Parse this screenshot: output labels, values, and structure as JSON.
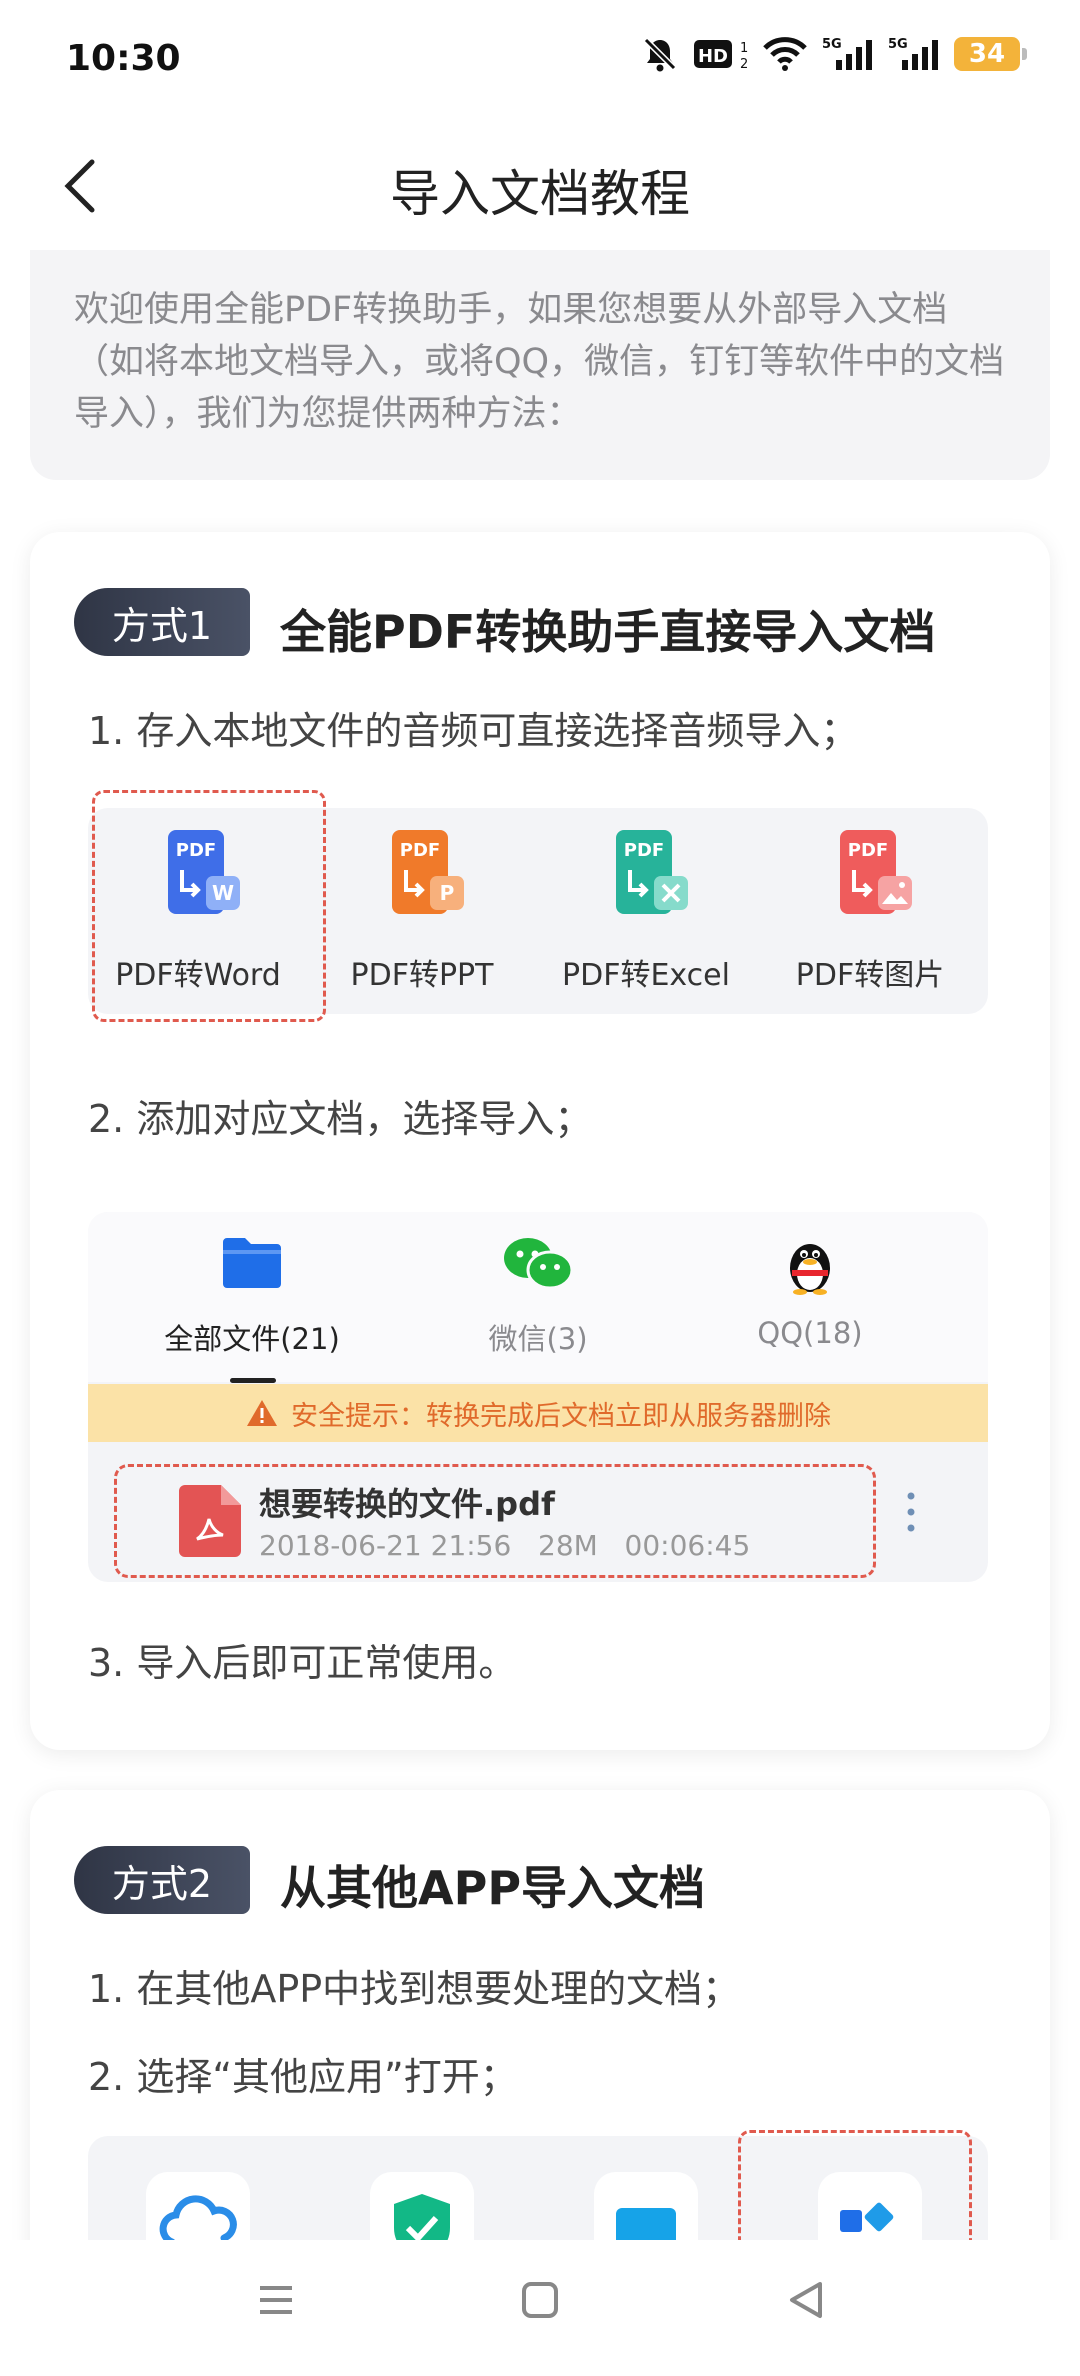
{
  "status_bar": {
    "time": "10:30",
    "battery": "34",
    "icons": [
      "bell-off-icon",
      "hd-icon",
      "wifi-icon",
      "5g-signal-icon",
      "5g-signal-icon",
      "battery-icon"
    ]
  },
  "nav": {
    "title": "导入文档教程",
    "back_icon": "chevron-left-icon"
  },
  "intro": {
    "text": "欢迎使用全能PDF转换助手，如果您想要从外部导入文档（如将本地文档导入，或将QQ，微信，钉钉等软件中的文档导入），我们为您提供两种方法："
  },
  "method1": {
    "badge": "方式1",
    "title": "全能PDF转换助手直接导入文档",
    "step1": "1. 存入本地文件的音频可直接选择音频导入；",
    "tools": [
      {
        "label": "PDF转Word",
        "color": "#3f6ee8",
        "letter": "W"
      },
      {
        "label": "PDF转PPT",
        "color": "#f07a2a",
        "letter": "P"
      },
      {
        "label": "PDF转Excel",
        "color": "#27b39a",
        "letter": "×"
      },
      {
        "label": "PDF转图片",
        "color": "#ef5c5c",
        "letter": "img"
      }
    ],
    "step2": "2. 添加对应文档，选择导入；",
    "file_tabs": [
      {
        "label": "全部文件(21)",
        "icon": "folder-icon"
      },
      {
        "label": "微信(3)",
        "icon": "wechat-icon"
      },
      {
        "label": "QQ(18)",
        "icon": "qq-penguin-icon"
      }
    ],
    "warning": "安全提示：转换完成后文档立即从服务器删除",
    "file": {
      "name": "想要转换的文件.pdf",
      "date": "2018-06-21 21:56",
      "size": "28M",
      "duration": "00:06:45"
    },
    "step3": "3. 导入后即可正常使用。"
  },
  "method2": {
    "badge": "方式2",
    "title": "从其他APP导入文档",
    "step1": "1. 在其他APP中找到想要处理的文档；",
    "step2": "2. 选择“其他应用”打开；",
    "app_icons": [
      "cloud-icon",
      "shield-check-icon",
      "message-icon",
      "apps-icon"
    ]
  },
  "colors": {
    "accent_red": "#e05a4e",
    "warning_bg": "#fbe2a7",
    "warning_text": "#e06a2b"
  }
}
